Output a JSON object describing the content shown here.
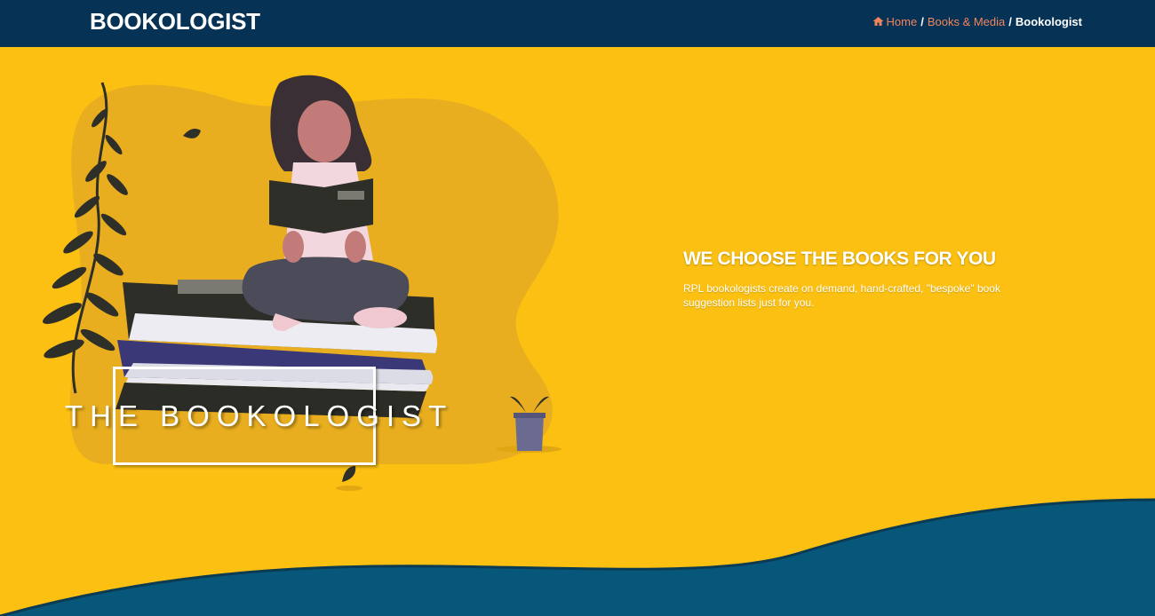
{
  "header": {
    "brand": "BOOKOLOGIST",
    "breadcrumb": {
      "home": "Home",
      "separator": "/",
      "parent": "Books & Media",
      "current": "Bookologist"
    }
  },
  "hero": {
    "title": "WE CHOOSE THE BOOKS FOR YOU",
    "description": "RPL bookologists create on demand, hand-crafted, \"bespoke\" book suggestion lists just for you.",
    "logo_text": "THE BOOKOLOGIST"
  },
  "colors": {
    "header_bg": "#063355",
    "hero_bg": "#fbc012",
    "wave": "#07577a",
    "link": "#f2845c"
  },
  "icons": {
    "home": "home-icon"
  }
}
